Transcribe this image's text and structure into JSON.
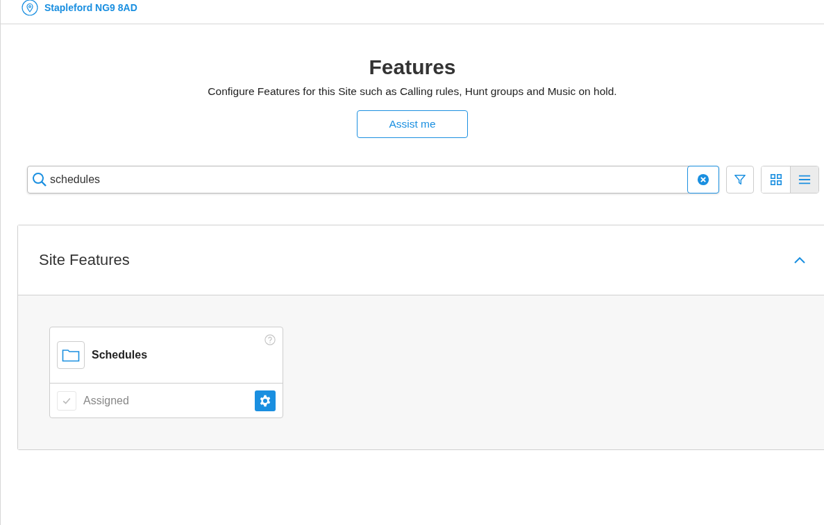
{
  "location": "Stapleford NG9 8AD",
  "header": {
    "title": "Features",
    "subtitle": "Configure Features for this Site such as Calling rules, Hunt groups and Music on hold.",
    "assist_button": "Assist me"
  },
  "search": {
    "value": "schedules"
  },
  "view_modes": [
    {
      "kind": "grid",
      "selected": false
    },
    {
      "kind": "list",
      "selected": true
    }
  ],
  "section": {
    "title": "Site Features",
    "expanded": true,
    "cards": [
      {
        "title": "Schedules",
        "status": "Assigned",
        "checked": true,
        "disabled": true
      }
    ]
  }
}
